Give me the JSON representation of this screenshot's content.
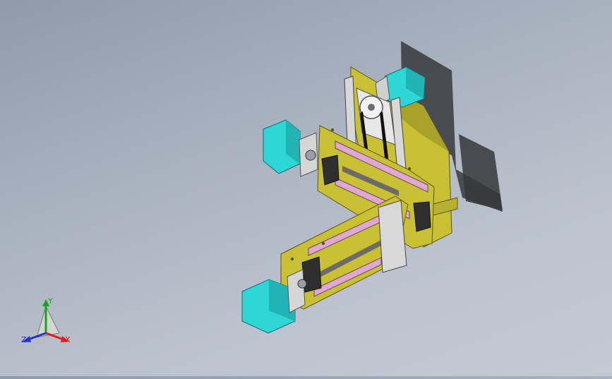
{
  "viewport": {
    "background_top": "#8f9aab",
    "background_bottom": "#c4cad3"
  },
  "model": {
    "plate_color": "#c9c034",
    "motor_color": "#2fd6d6",
    "rail_color": "#e3a5d2",
    "block_color": "#c8c8c8"
  },
  "triad": {
    "x_label": "X",
    "y_label": "Y",
    "z_label": "Z",
    "x_color": "#d92020",
    "y_color": "#19a319",
    "z_color": "#2233cc"
  }
}
